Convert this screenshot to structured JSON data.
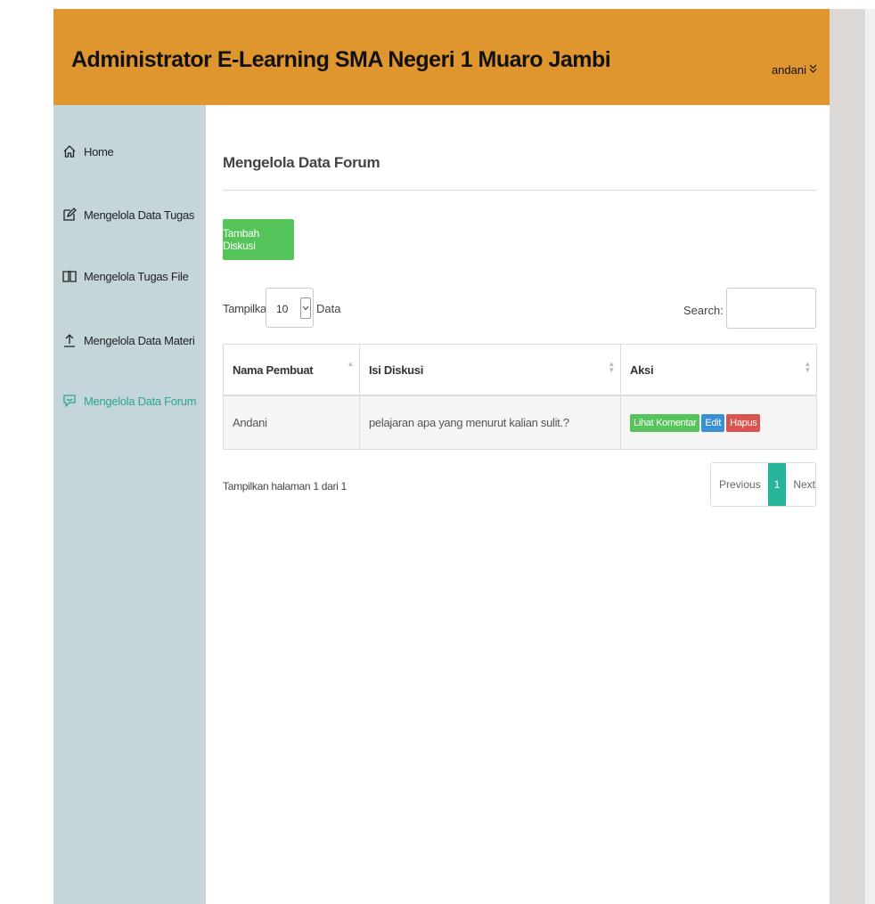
{
  "header": {
    "title": "Administrator E-Learning SMA Negeri 1 Muaro Jambi",
    "user": "andani",
    "user_chevron": "≫"
  },
  "sidebar": {
    "items": [
      {
        "label": "Home",
        "icon": "home-icon"
      },
      {
        "label": "Mengelola Data Tugas",
        "icon": "edit-icon"
      },
      {
        "label": "Mengelola Tugas File",
        "icon": "book-icon"
      },
      {
        "label": "Mengelola Data Materi",
        "icon": "upload-icon"
      },
      {
        "label": "Mengelola Data Forum",
        "icon": "comment-icon",
        "active": true
      }
    ]
  },
  "main": {
    "title": "Mengelola Data Forum",
    "add_button": "Tambah Diskusi",
    "length": {
      "before": "Tampilkan",
      "value": "10",
      "after": "Data"
    },
    "search": {
      "label": "Search:",
      "value": ""
    },
    "table": {
      "headers": [
        "Nama Pembuat",
        "Isi Diskusi",
        "Aksi"
      ],
      "rows": [
        {
          "nama": "Andani",
          "isi": "pelajaran apa yang menurut kalian sulit.?",
          "actions": {
            "view": "Lihat Komentar",
            "edit": "Edit",
            "delete": "Hapus"
          }
        }
      ]
    },
    "info": "Tampilkan halaman 1 dari 1",
    "pagination": {
      "previous": "Previous",
      "current": "1",
      "next": "Next"
    }
  },
  "colors": {
    "header_bg": "#e0962f",
    "sidebar_bg": "#c5d6da",
    "active_link": "#2aa693",
    "btn_green": "#55c45a",
    "btn_blue": "#3b8fd3",
    "btn_red": "#d9534f",
    "page_active": "#26b49a"
  }
}
